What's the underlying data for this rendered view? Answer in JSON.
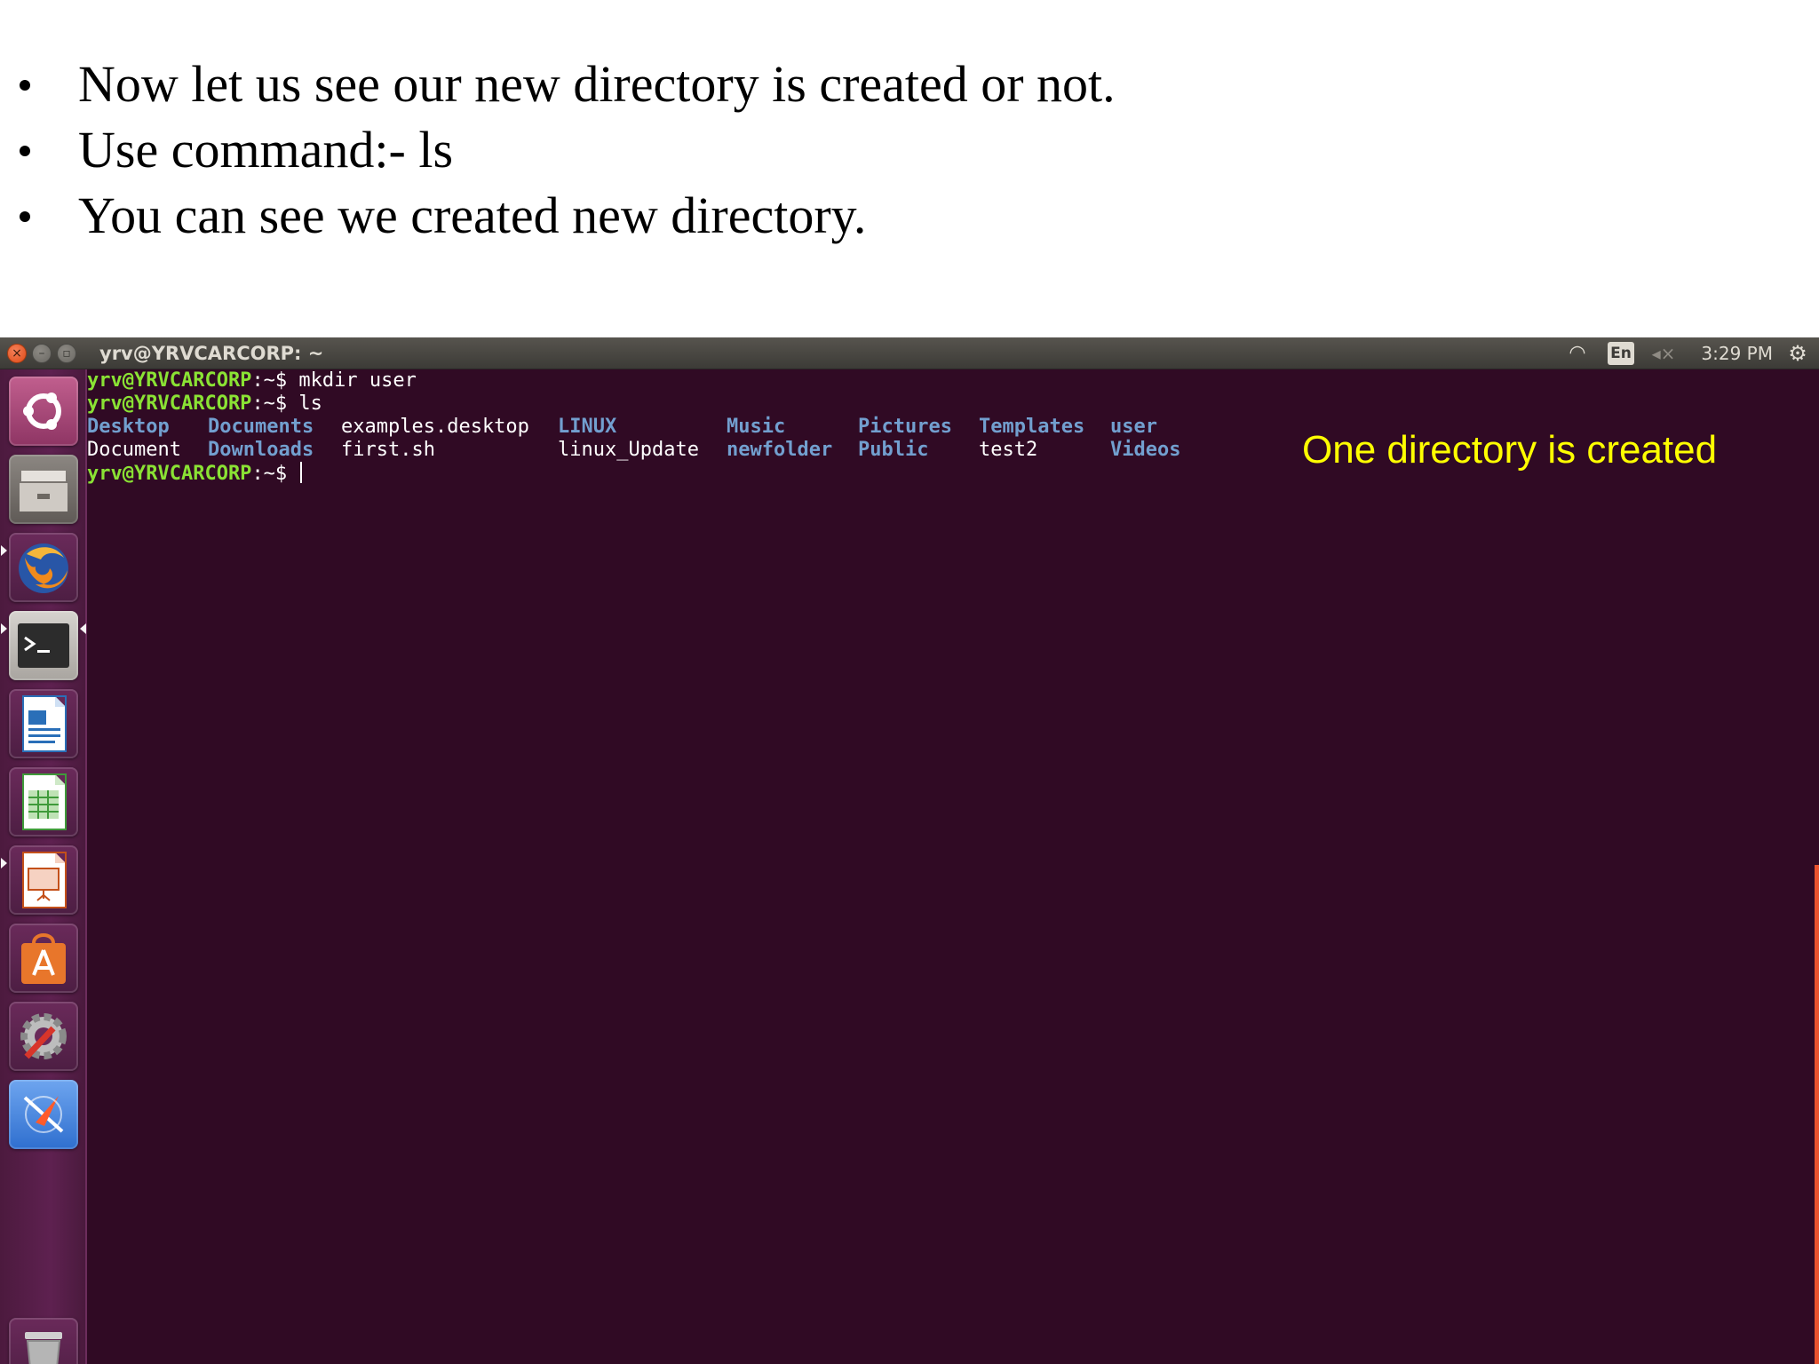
{
  "slide": {
    "bullets": [
      "Now let us see our new directory is created or not.",
      "Use command:- ls",
      "You can see we created new directory."
    ]
  },
  "topbar": {
    "window_title": "yrv@YRVCARCORP: ~",
    "close_glyph": "×",
    "minimize_glyph": "–",
    "maximize_glyph": "▫",
    "wifi_glyph": "◠",
    "language": "En",
    "volume_glyph": "◂×",
    "time": "3:29 PM",
    "settings_glyph": "⚙"
  },
  "launcher": {
    "items": [
      {
        "name": "ubuntu-dash-icon",
        "color": "#a0436f"
      },
      {
        "name": "files-icon",
        "color": "#7a7470"
      },
      {
        "name": "firefox-icon",
        "color": "#e66000"
      },
      {
        "name": "terminal-icon",
        "color": "#2c2c2c"
      },
      {
        "name": "writer-icon",
        "color": "#2a6fb8"
      },
      {
        "name": "calc-icon",
        "color": "#3f9a3a"
      },
      {
        "name": "impress-icon",
        "color": "#c4501a"
      },
      {
        "name": "software-center-icon",
        "color": "#e8762b"
      },
      {
        "name": "system-settings-icon",
        "color": "#8a8a8a"
      },
      {
        "name": "amazon-icon",
        "color": "#3d7fd6"
      },
      {
        "name": "trash-icon",
        "color": "#9c9c9c"
      }
    ]
  },
  "terminal": {
    "prompt": "yrv@YRVCARCORP",
    "prompt_suffix": ":~$ ",
    "line1_cmd": "mkdir user",
    "line2_cmd": "ls",
    "ls_row1": [
      {
        "text": "Desktop",
        "type": "dir"
      },
      {
        "text": "Documents",
        "type": "dir"
      },
      {
        "text": "examples.desktop",
        "type": "file"
      },
      {
        "text": "LINUX",
        "type": "dir"
      },
      {
        "text": "Music",
        "type": "dir"
      },
      {
        "text": "Pictures",
        "type": "dir"
      },
      {
        "text": "Templates",
        "type": "dir"
      },
      {
        "text": "user",
        "type": "dir"
      }
    ],
    "ls_row2": [
      {
        "text": "Document",
        "type": "file"
      },
      {
        "text": "Downloads",
        "type": "dir"
      },
      {
        "text": "first.sh",
        "type": "file"
      },
      {
        "text": "linux_Update",
        "type": "file"
      },
      {
        "text": "newfolder",
        "type": "dir"
      },
      {
        "text": "Public",
        "type": "dir"
      },
      {
        "text": "test2",
        "type": "file"
      },
      {
        "text": "Videos",
        "type": "dir"
      }
    ]
  },
  "annotation": "One directory is created",
  "colors": {
    "terminal_bg": "#300a24",
    "prompt": "#8ae234",
    "directory": "#729fcf",
    "annotation": "#ffff00"
  }
}
